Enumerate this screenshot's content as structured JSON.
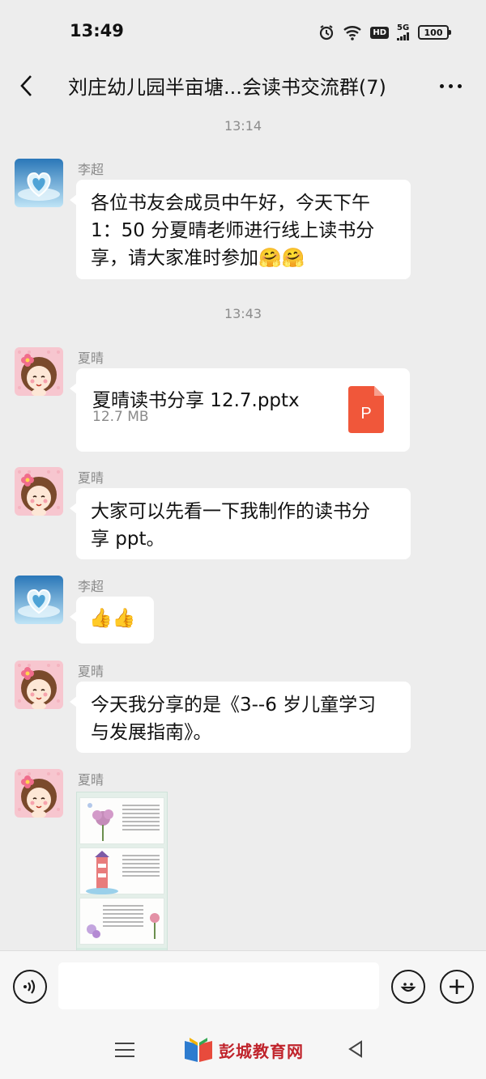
{
  "status_bar": {
    "time": "13:49",
    "battery": "100",
    "hd": "HD",
    "signal": "5G",
    "icons": [
      "alarm-icon",
      "wifi-icon",
      "hd-icon",
      "signal-icon",
      "battery-icon"
    ]
  },
  "header": {
    "title": "刘庄幼儿园半亩塘...会读书交流群(7)",
    "back_icon": "chevron-left-icon",
    "more_icon": "more-horizontal-icon"
  },
  "timestamps": [
    "13:14",
    "13:43"
  ],
  "messages": [
    {
      "sender": "李超",
      "type": "text",
      "text_lines": [
        "各位书友会成员中午好，今天下午",
        "1：50 分夏晴老师进行线上读书分",
        "享，请大家准时参加"
      ],
      "emoji": "🤗🤗"
    },
    {
      "sender": "夏晴",
      "type": "file",
      "file_name": "夏晴读书分享 12.7.pptx",
      "file_size": "12.7 MB",
      "file_icon_letter": "P",
      "file_icon_color": "#f0573a"
    },
    {
      "sender": "夏晴",
      "type": "text",
      "text_lines": [
        "大家可以先看一下我制作的读书分",
        "享 ppt。"
      ]
    },
    {
      "sender": "李超",
      "type": "text",
      "text_lines": [
        ""
      ],
      "emoji": "👍👍"
    },
    {
      "sender": "夏晴",
      "type": "text",
      "text_lines": [
        "今天我分享的是《3--6 岁儿童学习",
        "与发展指南》。"
      ]
    },
    {
      "sender": "夏晴",
      "type": "image"
    }
  ],
  "input_bar": {
    "placeholder": "",
    "voice_icon": "voice-icon",
    "emoji_icon": "emoji-icon",
    "plus_icon": "plus-icon"
  },
  "nav_bar": {
    "watermark": "彭城教育网"
  },
  "colors": {
    "background": "#ededed",
    "bubble": "#ffffff",
    "file_icon": "#f0573a",
    "watermark": "#c0242c"
  }
}
